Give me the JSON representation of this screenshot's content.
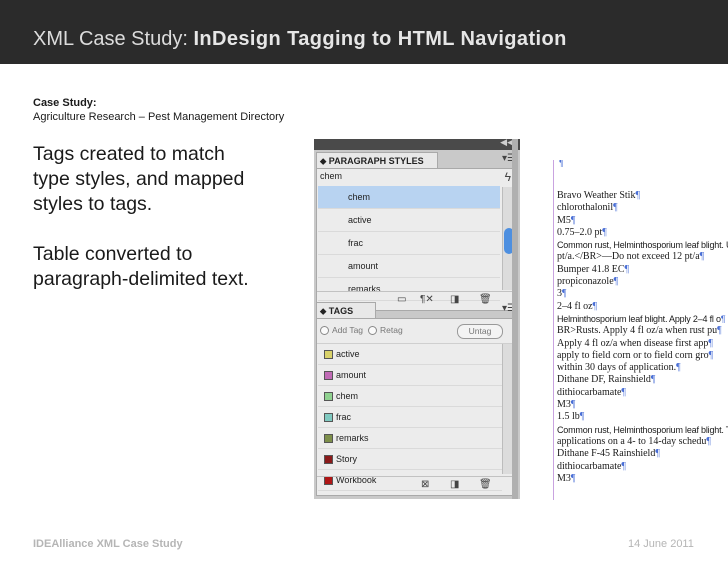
{
  "header": {
    "prefix": "XML Case Study: ",
    "title": "InDesign Tagging to HTML Navigation"
  },
  "subhead": {
    "label": "Case Study:",
    "text": "Agriculture Research – Pest Management Directory"
  },
  "bullets": {
    "line1": "Tags created to match",
    "line2": "type styles, and mapped",
    "line3": "styles to tags.",
    "line4": "Table converted to",
    "line5": "paragraph-delimited text."
  },
  "paragraph_panel": {
    "tab": "⬥ PARAGRAPH STYLES",
    "current": "chem",
    "styles": [
      "chem",
      "active",
      "frac",
      "amount",
      "remarks"
    ],
    "selected": "chem"
  },
  "tags_panel": {
    "tab": "⬥ TAGS",
    "add_tag": "Add Tag",
    "retag": "Retag",
    "untag": "Untag",
    "tags": [
      {
        "name": "active",
        "color": "#d9d26a"
      },
      {
        "name": "amount",
        "color": "#c06ab5"
      },
      {
        "name": "chem",
        "color": "#8fd18f"
      },
      {
        "name": "frac",
        "color": "#7fc9c0"
      },
      {
        "name": "remarks",
        "color": "#7d8f4a"
      },
      {
        "name": "Story",
        "color": "#8a1a1a"
      },
      {
        "name": "Workbook",
        "color": "#b01616"
      }
    ]
  },
  "document_lines": [
    {
      "t": "Bravo Weather Stik",
      "n": false
    },
    {
      "t": "chlorothalonil",
      "n": false
    },
    {
      "t": "M5",
      "n": false
    },
    {
      "t": "0.75–2.0 pt",
      "n": false
    },
    {
      "t": "Common rust, Helminthosporium leaf blight. Us",
      "n": true
    },
    {
      "t": "pt/a.</BR>—Do not exceed 12 pt/a",
      "n": false
    },
    {
      "t": "Bumper 41.8 EC",
      "n": false
    },
    {
      "t": "propiconazole",
      "n": false
    },
    {
      "t": "3",
      "n": false
    },
    {
      "t": "2–4 fl oz",
      "n": false
    },
    {
      "t": "Helminthosporium leaf blight. Apply 2–4 fl o",
      "n": true
    },
    {
      "t": "BR>Rusts. Apply 4 fl oz/a when rust pu",
      "n": false
    },
    {
      "t": "Apply 4 fl oz/a when disease first app",
      "n": false
    },
    {
      "t": "apply to field corn or to field corn gro",
      "n": false
    },
    {
      "t": "within 30 days of application.",
      "n": false
    },
    {
      "t": "Dithane DF, Rainshield",
      "n": false
    },
    {
      "t": "dithiocarbamate",
      "n": false
    },
    {
      "t": "M3",
      "n": false
    },
    {
      "t": "1.5 lb",
      "n": false
    },
    {
      "t": "Common rust, Helminthosporium leaf blight. Tre",
      "n": true
    },
    {
      "t": "applications on a 4- to 14-day schedu",
      "n": false
    },
    {
      "t": "Dithane F-45 Rainshield",
      "n": false
    },
    {
      "t": "dithiocarbamate",
      "n": false
    },
    {
      "t": "M3",
      "n": false
    }
  ],
  "footer": {
    "left": "IDEAlliance XML Case Study",
    "right": "14 June 2011"
  }
}
